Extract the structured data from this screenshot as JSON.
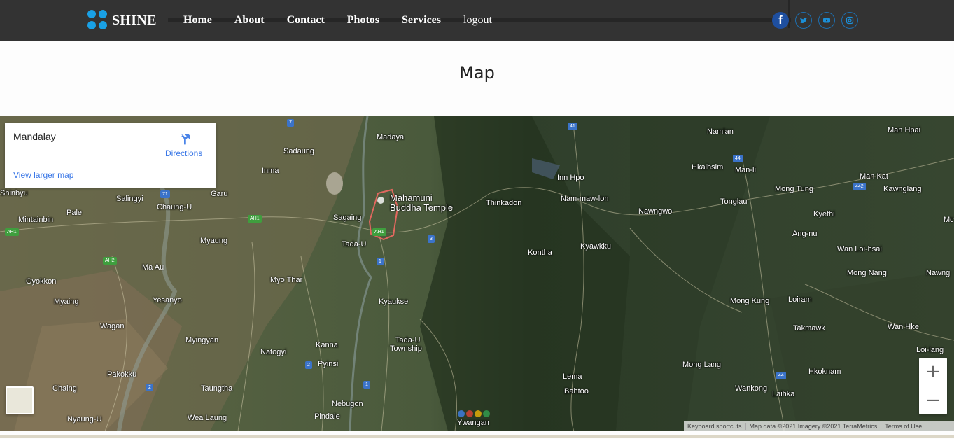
{
  "header": {
    "brand": "SHINE",
    "nav": [
      "Home",
      "About",
      "Contact",
      "Photos",
      "Services",
      "logout"
    ],
    "socials": [
      {
        "name": "facebook-icon",
        "glyph": "f"
      },
      {
        "name": "twitter-icon",
        "glyph": "t"
      },
      {
        "name": "youtube-icon",
        "glyph": "▶"
      },
      {
        "name": "instagram-icon",
        "glyph": "◻"
      }
    ]
  },
  "page": {
    "title": "Map"
  },
  "map": {
    "info": {
      "place": "Mandalay",
      "directions": "Directions",
      "larger_map": "View larger map"
    },
    "labels": [
      "Madaya",
      "Sadaung",
      "Inma",
      "Garu",
      "Sagaing",
      "Mahamuni",
      "Buddha Temple",
      "Thinkadon",
      "Inn Hpo",
      "Nam-maw-lon",
      "Nawngwo",
      "Namlan",
      "Hkaihsim",
      "Man-li",
      "Man Hpai",
      "Man Kat",
      "Mong Tung",
      "Kawnglang",
      "Tonglau",
      "Kyethi",
      "Ang-nu",
      "Wan Loi-hsai",
      "Kontha",
      "Kyawkku",
      "Tada-U",
      "Myaung",
      "Pale",
      "Mintainbin",
      "Salingyi",
      "Chaung-U",
      "Ma Au",
      "Gyokkon",
      "Myo Thar",
      "Kyaukse",
      "Mong Nang",
      "Nawng",
      "Mong Kung",
      "Loiram",
      "Takmawk",
      "Wan Hke",
      "Loi-lang",
      "Hkoknam",
      "Mong Lang",
      "Wankong",
      "Laihka",
      "Lema",
      "Bahtoo",
      "Yesanyo",
      "Myaing",
      "Wagan",
      "Myingyan",
      "Natogyi",
      "Kanna",
      "Tada-U",
      "Township",
      "Pyinsi",
      "Pakokku",
      "Chaing",
      "Taungtha",
      "Nebugon",
      "Pindale",
      "Wea Laung",
      "Nyaung-U",
      "Ywangan",
      "Shinbyu",
      "Mc"
    ],
    "routes": [
      "7",
      "41",
      "44",
      "442",
      "AH1",
      "71",
      "AH1",
      "AH1",
      "AH2",
      "3",
      "1",
      "2",
      "1",
      "2",
      "44"
    ],
    "zoom_in": "+",
    "zoom_out": "−",
    "attribution": [
      "Keyboard shortcuts",
      "Map data ©2021 Imagery ©2021 TerraMetrics",
      "Terms of Use"
    ]
  },
  "colors": {
    "navbar": "#333333",
    "accent": "#19a1e6",
    "link": "#3b78e7",
    "page_bg": "#fdfdfd"
  }
}
